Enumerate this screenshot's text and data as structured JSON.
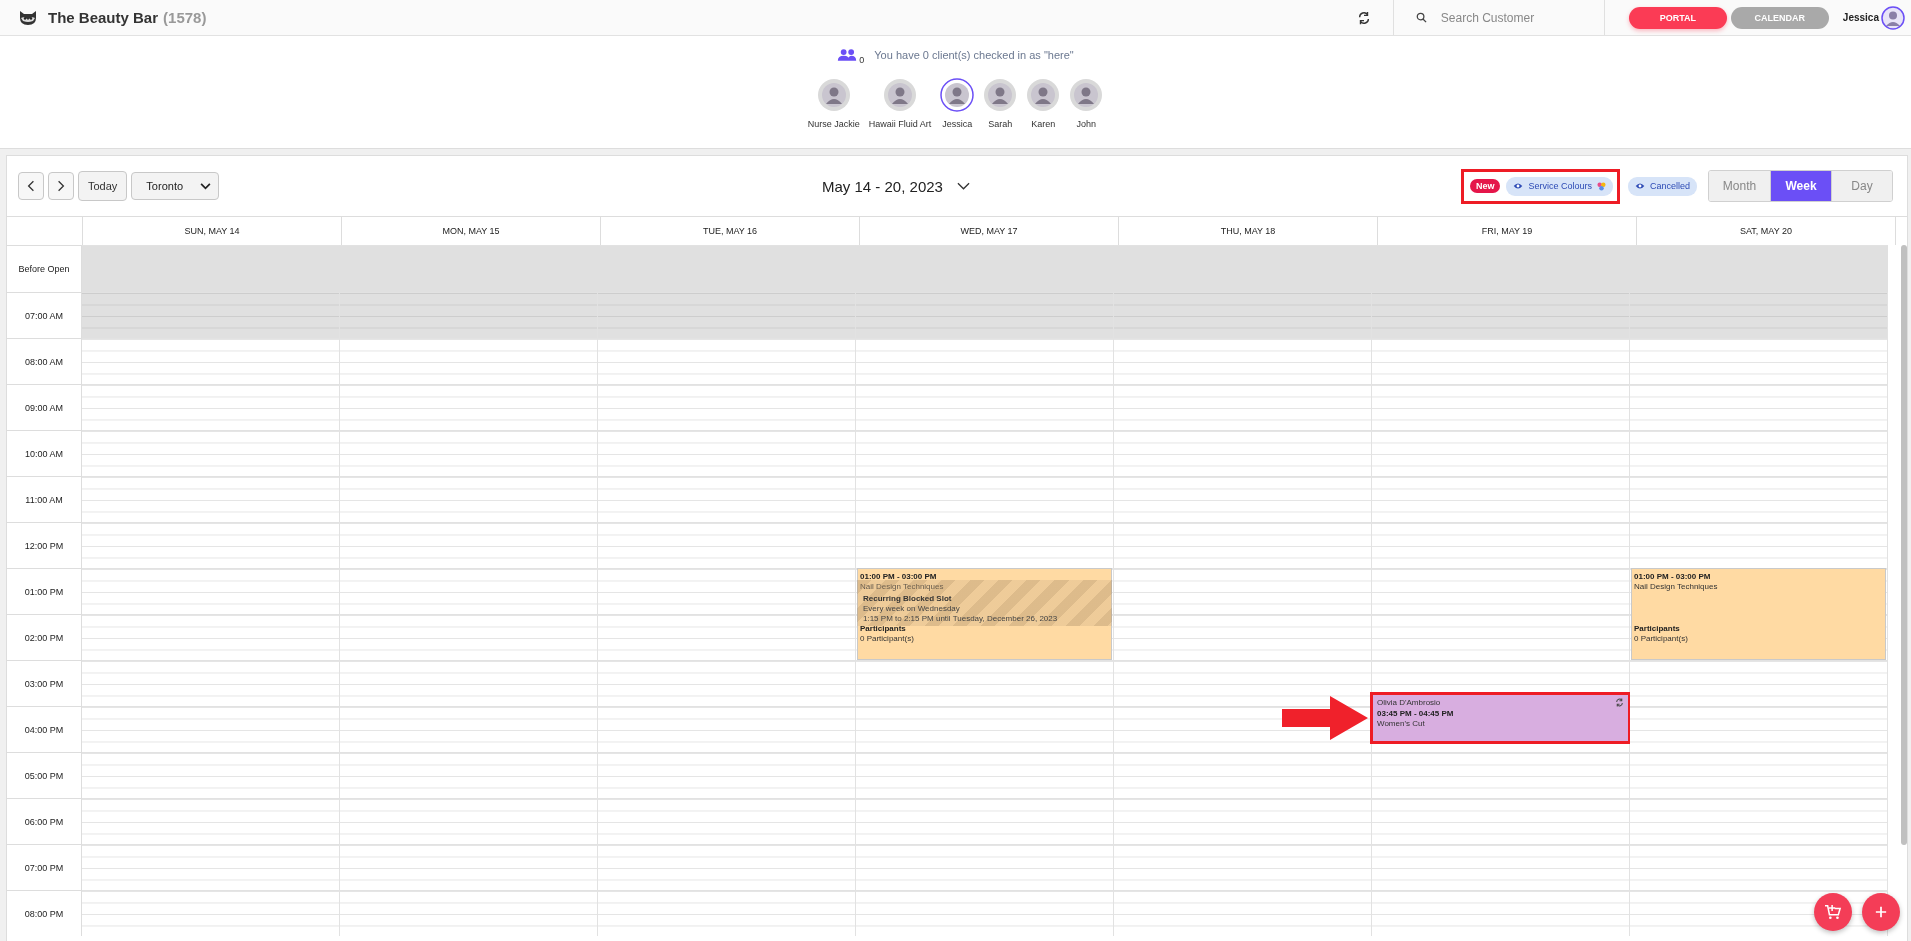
{
  "header": {
    "business_name": "The Beauty Bar",
    "count": "(1578)",
    "search": {
      "placeholder": "Search Customer"
    },
    "buttons": [
      {
        "label": "PORTAL",
        "selected": true
      },
      {
        "label": "CALENDAR",
        "selected": false
      }
    ],
    "user": "Jessica"
  },
  "checkin": {
    "count": "0",
    "message": "You have 0 client(s) checked in as \"here\""
  },
  "staff": [
    {
      "name": "Nurse Jackie",
      "selected": false
    },
    {
      "name": "Hawaii Fluid Art",
      "selected": false
    },
    {
      "name": "Jessica",
      "selected": true
    },
    {
      "name": "Sarah",
      "selected": false
    },
    {
      "name": "Karen",
      "selected": false
    },
    {
      "name": "John",
      "selected": false
    }
  ],
  "toolbar": {
    "today": "Today",
    "timezone": "Toronto",
    "range": "May 14 - 20, 2023",
    "new_badge": "New",
    "highlighted": true,
    "toggles": [
      "Service Colours",
      "Cancelled"
    ],
    "views": [
      {
        "label": "Month",
        "selected": false
      },
      {
        "label": "Week",
        "selected": true
      },
      {
        "label": "Day",
        "selected": false
      }
    ]
  },
  "calendar": {
    "time_slots": [
      {
        "label": "Before Open",
        "closed": true
      },
      {
        "label": "07:00 AM",
        "closed": true
      },
      {
        "label": "08:00 AM",
        "closed": false
      },
      {
        "label": "09:00 AM",
        "closed": false
      },
      {
        "label": "10:00 AM",
        "closed": false
      },
      {
        "label": "11:00 AM",
        "closed": false
      },
      {
        "label": "12:00 PM",
        "closed": false
      },
      {
        "label": "01:00 PM",
        "closed": false
      },
      {
        "label": "02:00 PM",
        "closed": false
      },
      {
        "label": "03:00 PM",
        "closed": false
      },
      {
        "label": "04:00 PM",
        "closed": false
      },
      {
        "label": "05:00 PM",
        "closed": false
      },
      {
        "label": "06:00 PM",
        "closed": false
      },
      {
        "label": "07:00 PM",
        "closed": false
      },
      {
        "label": "08:00 PM",
        "closed": false
      }
    ],
    "days": [
      {
        "label": "SUN, MAY 14"
      },
      {
        "label": "MON, MAY 15"
      },
      {
        "label": "TUE, MAY 16"
      },
      {
        "label": "WED, MAY 17",
        "events": [
          {
            "kind": "class",
            "time": "01:00 PM - 03:00 PM",
            "title": "Nail Design Techniques",
            "participants_label": "Participants",
            "participants": "0 Participant(s)",
            "color": "#ffdaa3"
          },
          {
            "kind": "blocked",
            "title": "Recurring Blocked Slot",
            "recurrence": "Every week on Wednesday",
            "time": "1:15 PM to 2:15 PM until Tuesday, December 26, 2023"
          }
        ]
      },
      {
        "label": "THU, MAY 18"
      },
      {
        "label": "FRI, MAY 19",
        "events": [
          {
            "kind": "appointment",
            "client": "Olivia D'Ambrosio",
            "time": "03:45 PM - 04:45 PM",
            "service": "Women's Cut",
            "color": "#d8aee0",
            "recurring": true,
            "highlighted": true
          }
        ]
      },
      {
        "label": "SAT, MAY 20",
        "events": [
          {
            "kind": "class",
            "time": "01:00 PM - 03:00 PM",
            "title": "Nail Design Techniques",
            "participants_label": "Participants",
            "participants": "0 Participant(s)",
            "color": "#ffdaa3"
          }
        ]
      }
    ]
  }
}
